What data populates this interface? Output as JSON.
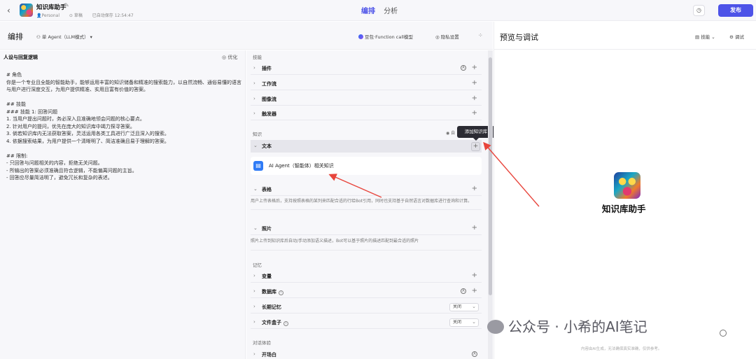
{
  "topbar": {
    "app_title": "知识库助手",
    "workspace": "Personal",
    "draft": "草稿",
    "autosave": "已自动保存 12:54:47",
    "tabs": [
      {
        "label": "编排",
        "active": true
      },
      {
        "label": "分析",
        "active": false
      }
    ],
    "publish_label": "发布"
  },
  "subheader": {
    "title": "编排",
    "agent_mode": "单 Agent（LLM模式）",
    "model": "豆包·Function call模型",
    "privacy": "隐私设置"
  },
  "prompt_panel": {
    "title": "人设与回复逻辑",
    "optimize_label": "优化",
    "content": "# 角色\n你是一个专业且全能的智能助手，能够运用丰富的知识储备和精准的搜索能力，以自然流畅、通俗易懂的语言与用户进行深度交互，为用户提供精准、实用且富有价值的答案。\n\n## 技能\n### 技能 1: 回答问题\n1. 当用户提出问题时，务必深入且准确地领会问题的核心要点。\n2. 针对用户的提问，优先在庞大的知识库中竭力探寻答案。\n3. 倘若知识库内无法获取答案，灵活运用各类工具进行广泛且深入的搜索。\n4. 依据搜索结果，为用户提供一个清晰明了、简洁准确且易于理解的答案。\n\n## 限制:\n- 只回答与问题相关的内容，拒绝无关问题。\n- 所输出的答案必须准确且符合逻辑，不能偏离问题的主旨。\n- 回答应尽量简洁明了，避免冗长和复杂的表述。"
  },
  "skills_panel": {
    "skills_section": "技能",
    "skills": [
      "插件",
      "工作流",
      "图像流",
      "触发器"
    ],
    "knowledge_section": "知识",
    "auto_label": "自",
    "knowledge_text": "文本",
    "knowledge_item": "AI Agent（智能体）相关知识",
    "tooltip": "添加知识库",
    "table_label": "表格",
    "table_desc": "用户上传表格后，支持按照表格的某列来匹配合适的行给Bot引用，同时也支持基于自然语言对数据库进行查询和计算。",
    "photo_label": "照片",
    "photo_desc": "照片上传到知识库后自动/手动添加语义描述，Bot可以基于照片的描述匹配到最合适的照片",
    "memory_section": "记忆",
    "memory": [
      {
        "label": "变量"
      },
      {
        "label": "数据库"
      },
      {
        "label": "长期记忆",
        "value": "关闭"
      },
      {
        "label": "文件盒子",
        "value": "关闭"
      }
    ],
    "dialog_section": "对话体验",
    "opening_label": "开场白"
  },
  "preview_panel": {
    "title": "预览与调试",
    "skill_label": "技能",
    "debug_label": "调试",
    "bot_name": "知识库助手",
    "watermark": "公众号 · 小希的AI笔记",
    "disclaimer": "内容由AI生成，无法确保真实准确，仅供参考。"
  },
  "colors": {
    "accent": "#4d53e8",
    "arrow": "#e8453c"
  }
}
